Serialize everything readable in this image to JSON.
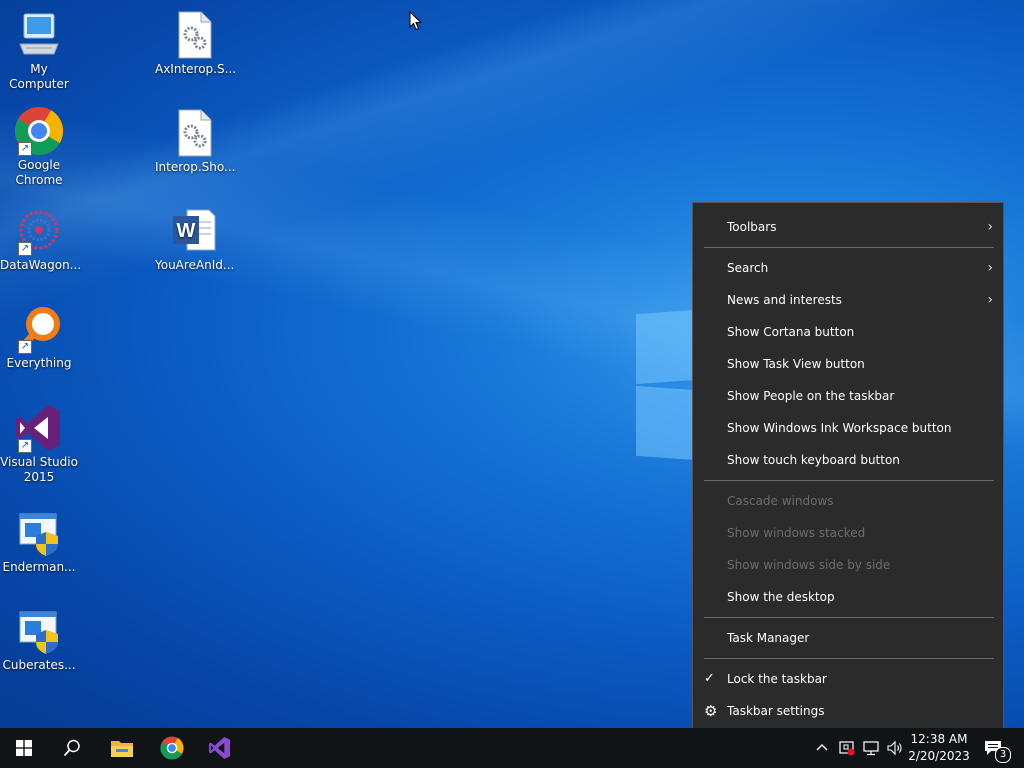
{
  "desktop": {
    "icons": [
      {
        "label": "My Computer"
      },
      {
        "label": "Google\nChrome"
      },
      {
        "label": "DataWagon..."
      },
      {
        "label": "Everything"
      },
      {
        "label": "Visual Studio\n2015"
      },
      {
        "label": "Enderman..."
      },
      {
        "label": "Cuberates..."
      },
      {
        "label": "AxInterop.S..."
      },
      {
        "label": "Interop.Sho..."
      },
      {
        "label": "YouAreAnId..."
      }
    ]
  },
  "context_menu": {
    "items": [
      {
        "label": "Toolbars",
        "submenu": true
      },
      {
        "label": "Search",
        "submenu": true
      },
      {
        "label": "News and interests",
        "submenu": true
      },
      {
        "label": "Show Cortana button"
      },
      {
        "label": "Show Task View button"
      },
      {
        "label": "Show People on the taskbar"
      },
      {
        "label": "Show Windows Ink Workspace button"
      },
      {
        "label": "Show touch keyboard button"
      },
      {
        "label": "Cascade windows",
        "disabled": true
      },
      {
        "label": "Show windows stacked",
        "disabled": true
      },
      {
        "label": "Show windows side by side",
        "disabled": true
      },
      {
        "label": "Show the desktop"
      },
      {
        "label": "Task Manager"
      },
      {
        "label": "Lock the taskbar",
        "checked": true
      },
      {
        "label": "Taskbar settings",
        "icon": "gear-icon"
      }
    ],
    "submenu_glyph": "›",
    "check_glyph": "✓",
    "gear_glyph": "⚙"
  },
  "taskbar": {
    "clock_time": "12:38 AM",
    "clock_date": "2/20/2023",
    "notification_count": "3",
    "tray_chevron": "^"
  },
  "colors": {
    "menu_bg": "#2b2b2b",
    "taskbar_bg": "#101417",
    "disabled_text": "#6d6d6d"
  }
}
